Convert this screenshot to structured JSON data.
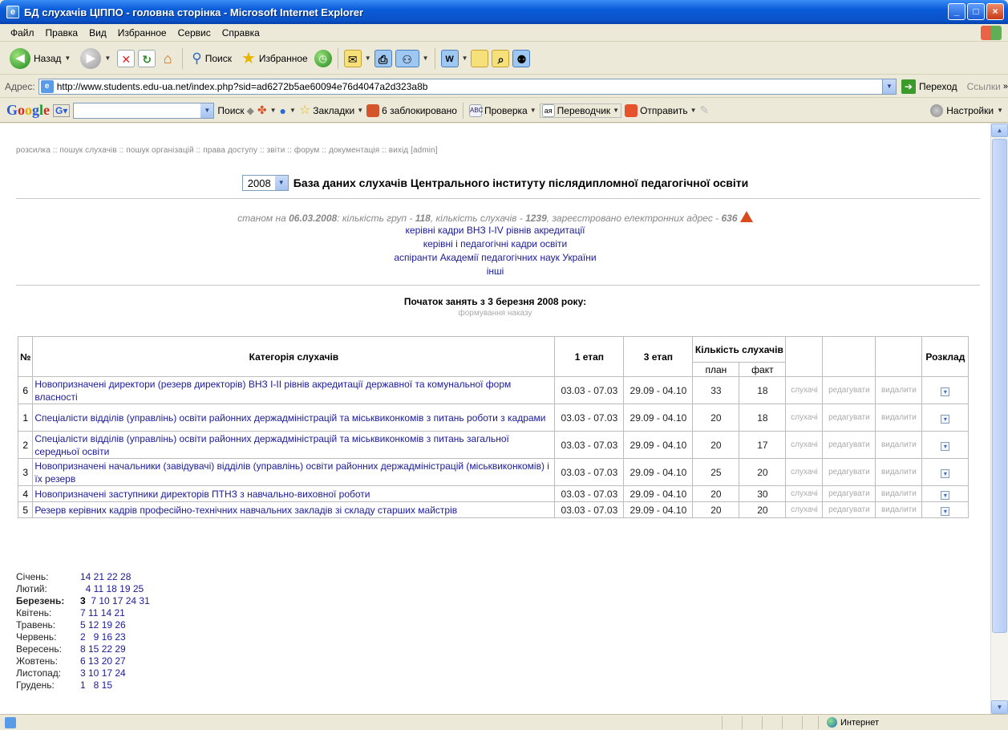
{
  "window": {
    "title": "БД слухачів ЦІППО - головна сторінка - Microsoft Internet Explorer",
    "controls": [
      "_",
      "□",
      "×"
    ]
  },
  "menu": [
    "Файл",
    "Правка",
    "Вид",
    "Избранное",
    "Сервис",
    "Справка"
  ],
  "toolbar": {
    "back": "Назад",
    "search": "Поиск",
    "favorites": "Избранное"
  },
  "address": {
    "label": "Адрес:",
    "url": "http://www.students.edu-ua.net/index.php?sid=ad6272b5ae60094e76d4047a2d323a8b",
    "go": "Переход",
    "links": "Ссылки"
  },
  "google_bar": {
    "search_btn": "Поиск",
    "bookmarks": "Закладки",
    "blocked": "6 заблокировано",
    "spell": "Проверка",
    "translator": "Переводчик",
    "send": "Отправить",
    "settings": "Настройки"
  },
  "nav": {
    "items": [
      "розсилка",
      "пошук слухачів",
      "пошук організацій",
      "права доступу",
      "звіти",
      "форум",
      "документація",
      "вихід [admin]"
    ],
    "separator": "::"
  },
  "header": {
    "year": "2008",
    "title": "База даних слухачів Центрального інституту післядипломної педагогічної освіти"
  },
  "stats": {
    "prefix": "станом на",
    "date": "06.03.2008",
    "groups_label": ": кількість груп -",
    "groups": "118",
    "listeners_label": ", кількість слухачів -",
    "listeners": "1239",
    "emails_label": ", зареєстровано електронних адрес -",
    "emails": "636"
  },
  "categories": [
    "керівні кадри ВНЗ І-IV рівнів акредитації",
    "керівні і педагогічні кадри освіти",
    "аспіранти Академії педагогічних наук України",
    "інші"
  ],
  "start": {
    "title": "Початок занять з 3 березня 2008 року:",
    "sub": "формування наказу"
  },
  "table": {
    "headers": {
      "num": "№",
      "category": "Категорія слухачів",
      "stage1": "1 етап",
      "stage3": "3 етап",
      "count": "Кількість слухачів",
      "plan": "план",
      "fact": "факт",
      "schedule": "Розклад"
    },
    "action_labels": {
      "listeners": "слухачі",
      "edit": "редагувати",
      "delete": "видалити"
    },
    "rows": [
      {
        "num": "6",
        "category": "Новопризначені директори (резерв директорів) ВНЗ І-ІІ рівнів акредитації державної та комунальної форм власності",
        "stage1": "03.03 - 07.03",
        "stage3": "29.09 - 04.10",
        "plan": "33",
        "fact": "18"
      },
      {
        "num": "1",
        "category": "Спеціалісти відділів (управлінь) освіти районних держадміністрацій та міськвиконкомів з питань роботи з кадрами",
        "stage1": "03.03 - 07.03",
        "stage3": "29.09 - 04.10",
        "plan": "20",
        "fact": "18"
      },
      {
        "num": "2",
        "category": "Спеціалісти відділів (управлінь) освіти районних держадміністрацій та міськвиконкомів з питань загальної середньої освіти",
        "stage1": "03.03 - 07.03",
        "stage3": "29.09 - 04.10",
        "plan": "20",
        "fact": "17"
      },
      {
        "num": "3",
        "category": "Новопризначені начальники (завідувачі) відділів (управлінь) освіти районних держадміністрацій (міськвиконкомів) і їх резерв",
        "stage1": "03.03 - 07.03",
        "stage3": "29.09 - 04.10",
        "plan": "25",
        "fact": "20"
      },
      {
        "num": "4",
        "category": "Новопризначені заступники директорів ПТНЗ з навчально-виховної роботи",
        "stage1": "03.03 - 07.03",
        "stage3": "29.09 - 04.10",
        "plan": "20",
        "fact": "30"
      },
      {
        "num": "5",
        "category": "Резерв керівних кадрів професійно-технічних навчальних закладів зі складу старших майстрів",
        "stage1": "03.03 - 07.03",
        "stage3": "29.09 - 04.10",
        "plan": "20",
        "fact": "20"
      }
    ]
  },
  "calendar": [
    {
      "month": "Січень:",
      "days": "14 21 22 28"
    },
    {
      "month": "Лютий:",
      "days": "  4 11 18 19 25"
    },
    {
      "month": "Березень:",
      "days": "3  7 10 17 24 31",
      "current": true,
      "current_day": "3",
      "rest_days": "  7 10 17 24 31"
    },
    {
      "month": "Квітень:",
      "days": "7 11 14 21"
    },
    {
      "month": "Травень:",
      "days": "5 12 19 26"
    },
    {
      "month": "Червень:",
      "days": "2   9 16 23"
    },
    {
      "month": "Вересень:",
      "days": "8 15 22 29"
    },
    {
      "month": "Жовтень:",
      "days": "6 13 20 27"
    },
    {
      "month": "Листопад:",
      "days": "3 10 17 24"
    },
    {
      "month": "Грудень:",
      "days": "1   8 15"
    }
  ],
  "status": {
    "zone": "Интернет"
  }
}
